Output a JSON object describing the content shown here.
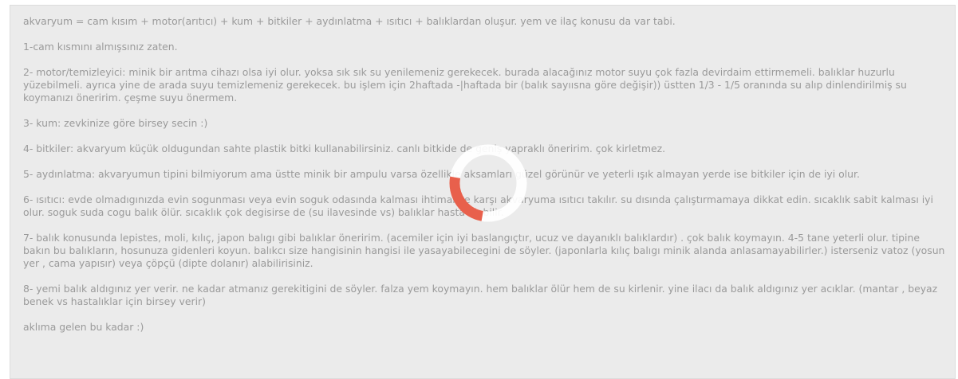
{
  "editor": {
    "paragraphs": [
      "akvaryum = cam kısım + motor(arıtıcı) + kum + bitkiler + aydınlatma + ısıtıcı + balıklardan oluşur. yem ve ilaç konusu da var tabi.",
      "1-cam kısmını almışsınız zaten.",
      "2- motor/temizleyici: minik bir arıtma cihazı olsa iyi olur. yoksa sık sık su yenilemeniz gerekecek. burada alacağınız motor suyu çok fazla devirdaim ettirmemeli. balıklar huzurlu yüzebilmeli. ayrıca yine de arada suyu temizlemeniz gerekecek. bu işlem için 2haftada -|haftada bir (balık sayıısna göre değişir)) üstten 1/3 - 1/5 oranında su alıp dinlendirilmiş su koymanızı öneririm. çeşme suyu önermem.",
      "3- kum: zevkinize göre birsey secin :)",
      "4- bitkiler: akvaryum küçük oldugundan sahte plastik bitki kullanabilirsiniz. canlı bitkide de geniş yapraklı öneririm. çok kirletmez.",
      "5- aydınlatma: akvaryumun tipini bilmiyorum ama üstte minik bir ampulu varsa özellikle aksamları güzel görünür ve yeterli ışık almayan yerde ise bitkiler için de iyi olur.",
      "6- ısıtıcı: evde olmadıgınızda evin sogunması veya evin soguk odasında kalması ihtimaline karşı akvaryuma ısıtıcı takılır. su dısında çalıştırmamaya dikkat edin. sıcaklık sabit kalması iyi olur. soguk suda cogu balık ölür. sıcaklık çok degisirse de (su ilavesinde vs) balıklar hasta olabilir.",
      "7- balık konusunda lepistes, moli, kılıç, japon balıgı gibi balıklar öneririm. (acemiler için iyi baslangıçtır, ucuz ve dayanıklı balıklardır) . çok balık koymayın. 4-5 tane yeterli olur. tipine bakın bu balıkların, hosunuza gidenleri koyun. balıkcı size hangisinin hangisi ile yasayabilecegini de söyler. (japonlarla kılıç balıgı minik alanda anlasamayabilirler.) isterseniz vatoz (yosun yer , cama yapısır) veya çöpçü (dipte dolanır) alabilirisiniz.",
      "8- yemi balık aldıgınız yer verir. ne kadar atmanız gerekitigini de söyler. falza yem koymayın. hem balıklar ölür hem de su kirlenir. yine ilacı da balık aldıgınız yer acıklar. (mantar , beyaz benek vs hastalıklar için birsey verir)",
      "aklıma gelen bu kadar :)"
    ]
  },
  "spinner": {
    "track_color": "#ffffff",
    "arc_color": "#e8604c",
    "progress": 0.25
  }
}
